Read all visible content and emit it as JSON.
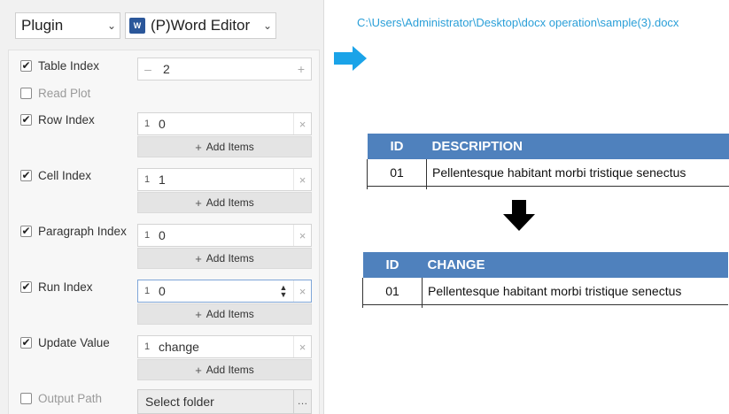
{
  "toolbar": {
    "category_select": "Plugin",
    "plugin_select": "(P)Word Editor",
    "word_icon_letter": "W"
  },
  "options": [
    {
      "label": "Table Index",
      "checked": true,
      "kind": "stepper",
      "value": "2"
    },
    {
      "label": "Read Plot",
      "checked": false,
      "kind": "none"
    },
    {
      "label": "Row Index",
      "checked": true,
      "kind": "list",
      "number": "1",
      "value": "0",
      "add_label": "Add Items"
    },
    {
      "label": "Cell Index",
      "checked": true,
      "kind": "list",
      "number": "1",
      "value": "1",
      "add_label": "Add Items"
    },
    {
      "label": "Paragraph Index",
      "checked": true,
      "kind": "list",
      "number": "1",
      "value": "0",
      "add_label": "Add Items"
    },
    {
      "label": "Run Index",
      "checked": true,
      "kind": "list",
      "number": "1",
      "value": "0",
      "add_label": "Add Items",
      "active": true
    },
    {
      "label": "Update Value",
      "checked": true,
      "kind": "list",
      "number": "1",
      "value": "change",
      "add_label": "Add Items"
    },
    {
      "label": "Output Path",
      "checked": false,
      "kind": "folder",
      "value": "Select folder"
    }
  ],
  "preview": {
    "file_path": "C:\\Users\\Administrator\\Desktop\\docx operation\\sample(3).docx",
    "before_table": {
      "headers": [
        "ID",
        "DESCRIPTION"
      ],
      "row": [
        "01",
        "Pellentesque habitant morbi tristique senectus"
      ]
    },
    "after_table": {
      "headers": [
        "ID",
        "CHANGE"
      ],
      "row": [
        "01",
        "Pellentesque habitant morbi tristique senectus"
      ]
    },
    "colors": {
      "header_bg": "#4f81bd",
      "path_text": "#2a9fd8",
      "arrow_blue": "#1aa3e8"
    }
  }
}
